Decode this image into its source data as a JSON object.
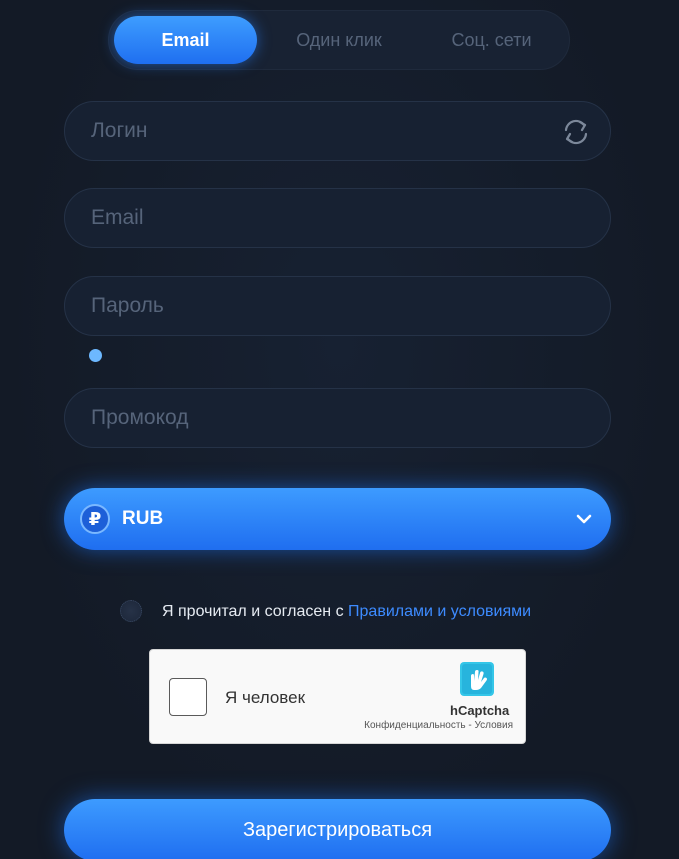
{
  "tabs": [
    {
      "label": "Email",
      "active": true
    },
    {
      "label": "Один клик",
      "active": false
    },
    {
      "label": "Соц. сети",
      "active": false
    }
  ],
  "fields": {
    "login": {
      "placeholder": "Логин",
      "value": ""
    },
    "email": {
      "placeholder": "Email",
      "value": ""
    },
    "password": {
      "placeholder": "Пароль",
      "value": ""
    },
    "promo": {
      "placeholder": "Промокод",
      "value": ""
    }
  },
  "currency": {
    "symbol": "₽",
    "label": "RUB",
    "icon": "ruble-icon",
    "dropdown_icon": "chevron-down-icon"
  },
  "agree": {
    "text": "Я прочитал и согласен с",
    "link": "Правилами и условиями",
    "checked": false
  },
  "captcha": {
    "label": "Я человек",
    "brand": "hCaptcha",
    "links": "Конфиденциальность - Условия",
    "checked": false
  },
  "submit_label": "Зарегистрироваться",
  "colors": {
    "background": "#141b27",
    "accent": "#2f86ff",
    "field_bg": "#172132",
    "link": "#3d8bff",
    "placeholder": "#56647a"
  },
  "icons": {
    "login_refresh": "refresh-icon",
    "hcaptcha": "hcaptcha-logo"
  }
}
